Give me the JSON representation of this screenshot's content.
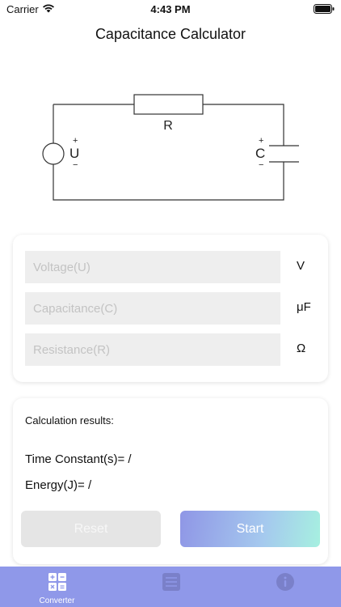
{
  "status": {
    "carrier": "Carrier",
    "time": "4:43 PM"
  },
  "title": "Capacitance Calculator",
  "circuit": {
    "resistor_label": "R",
    "source_label": "U",
    "source_plus": "+",
    "source_minus": "−",
    "capacitor_label": "C",
    "capacitor_plus": "+",
    "capacitor_minus": "−"
  },
  "inputs": [
    {
      "placeholder": "Voltage(U)",
      "value": "",
      "unit": "V"
    },
    {
      "placeholder": "Capacitance(C)",
      "value": "",
      "unit": "μF"
    },
    {
      "placeholder": "Resistance(R)",
      "value": "",
      "unit": "Ω"
    }
  ],
  "results": {
    "title": "Calculation results:",
    "time_constant_label": "Time Constant(s)= ",
    "time_constant_value": "/",
    "energy_label": "Energy(J)= ",
    "energy_value": "/"
  },
  "buttons": {
    "reset": "Reset",
    "start": "Start"
  },
  "tabs": [
    {
      "label": "Converter",
      "icon": "calculator-icon",
      "active": true
    },
    {
      "label": "",
      "icon": "list-icon",
      "active": false
    },
    {
      "label": "",
      "icon": "info-icon",
      "active": false
    }
  ],
  "colors": {
    "tab_bar": "#8f98e9",
    "button_start_from": "#8f96e6",
    "button_start_to": "#a6f0e0",
    "button_reset": "#e5e5e5",
    "input_bg": "#eeeeee"
  }
}
